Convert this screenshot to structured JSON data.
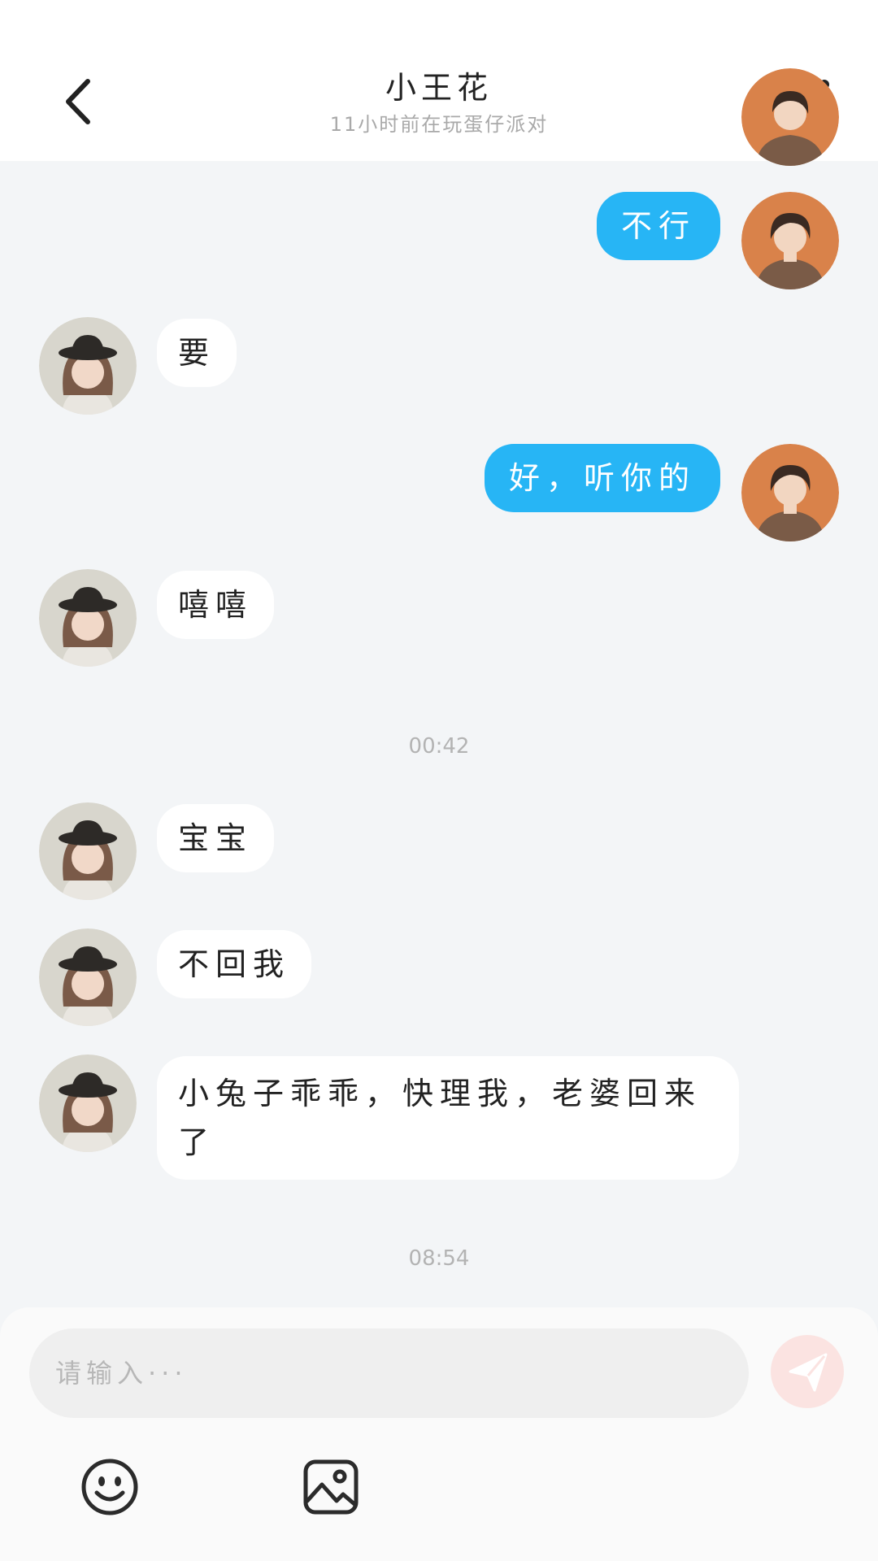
{
  "header": {
    "title": "小王花",
    "subtitle": "11小时前在玩蛋仔派对"
  },
  "messages": [
    {
      "text": "不行",
      "direction": "outgoing"
    },
    {
      "text": "要",
      "direction": "incoming"
    },
    {
      "text": "好，听你的",
      "direction": "outgoing"
    },
    {
      "text": "嘻嘻",
      "direction": "incoming"
    },
    {
      "text": "宝宝",
      "direction": "incoming"
    },
    {
      "text": "不回我",
      "direction": "incoming"
    },
    {
      "text": "小兔子乖乖，快理我，老婆回来了",
      "direction": "incoming"
    }
  ],
  "timestamps": [
    "00:42",
    "08:54"
  ],
  "composer": {
    "placeholder": "请输入···",
    "value": ""
  },
  "icons": {
    "back": "chevron-left-icon",
    "more": "more-vertical-icon",
    "send": "send-icon",
    "emoji": "emoji-icon",
    "image": "image-icon"
  },
  "colors": {
    "outgoing_bubble": "#27b5f5",
    "incoming_bubble": "#ffffff",
    "background": "#f3f5f7",
    "send_button": "#fbe3e1"
  }
}
